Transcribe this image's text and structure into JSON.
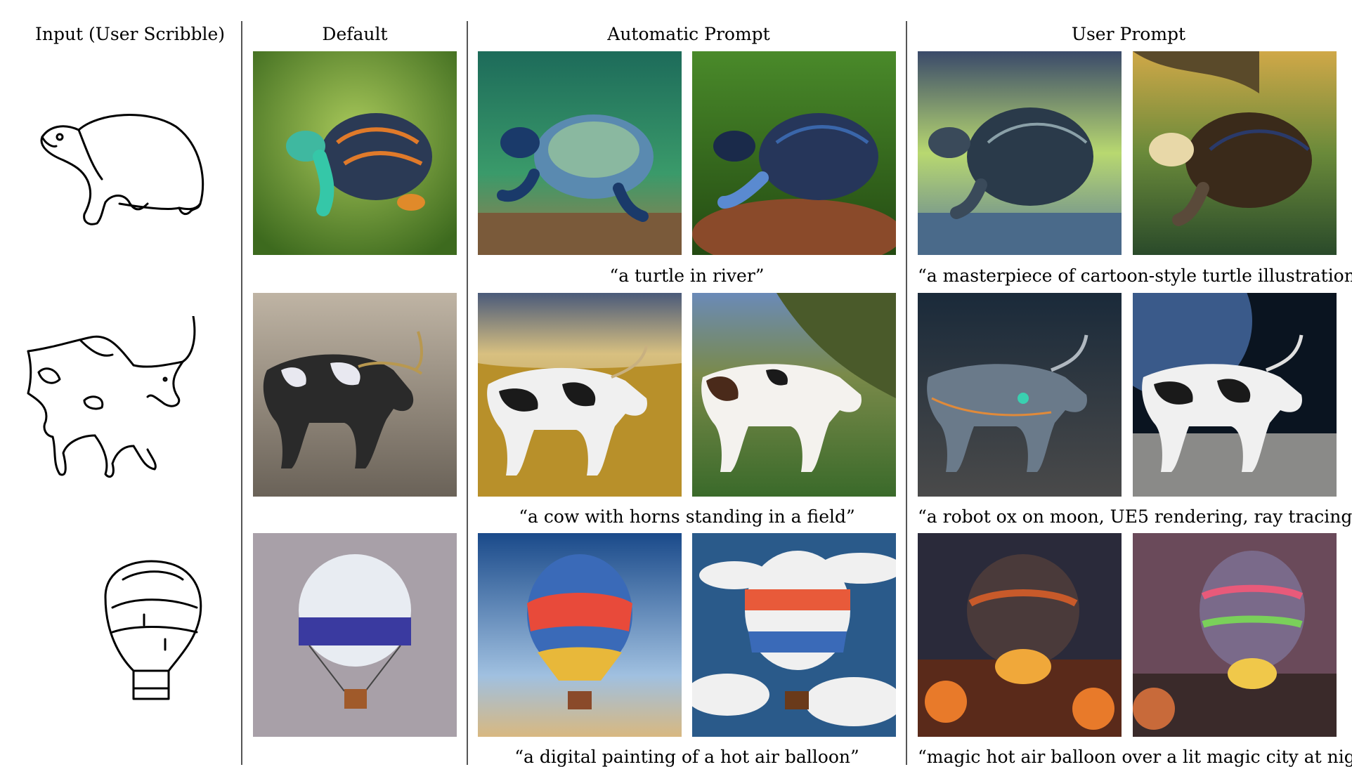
{
  "headers": {
    "input": "Input (User Scribble)",
    "default": "Default",
    "automatic": "Automatic Prompt",
    "user": "User Prompt"
  },
  "rows": [
    {
      "subject": "turtle",
      "automatic_caption": "“a turtle in river”",
      "user_caption": "“a masterpiece of cartoon-style turtle illustration”"
    },
    {
      "subject": "cow",
      "automatic_caption": "“a cow with horns standing in a field”",
      "user_caption": "“a robot ox on moon, UE5 rendering, ray tracing”"
    },
    {
      "subject": "hot air balloon",
      "automatic_caption": "“a digital painting of a hot air balloon”",
      "user_caption": "“magic hot air balloon over a lit magic city at night”"
    }
  ]
}
